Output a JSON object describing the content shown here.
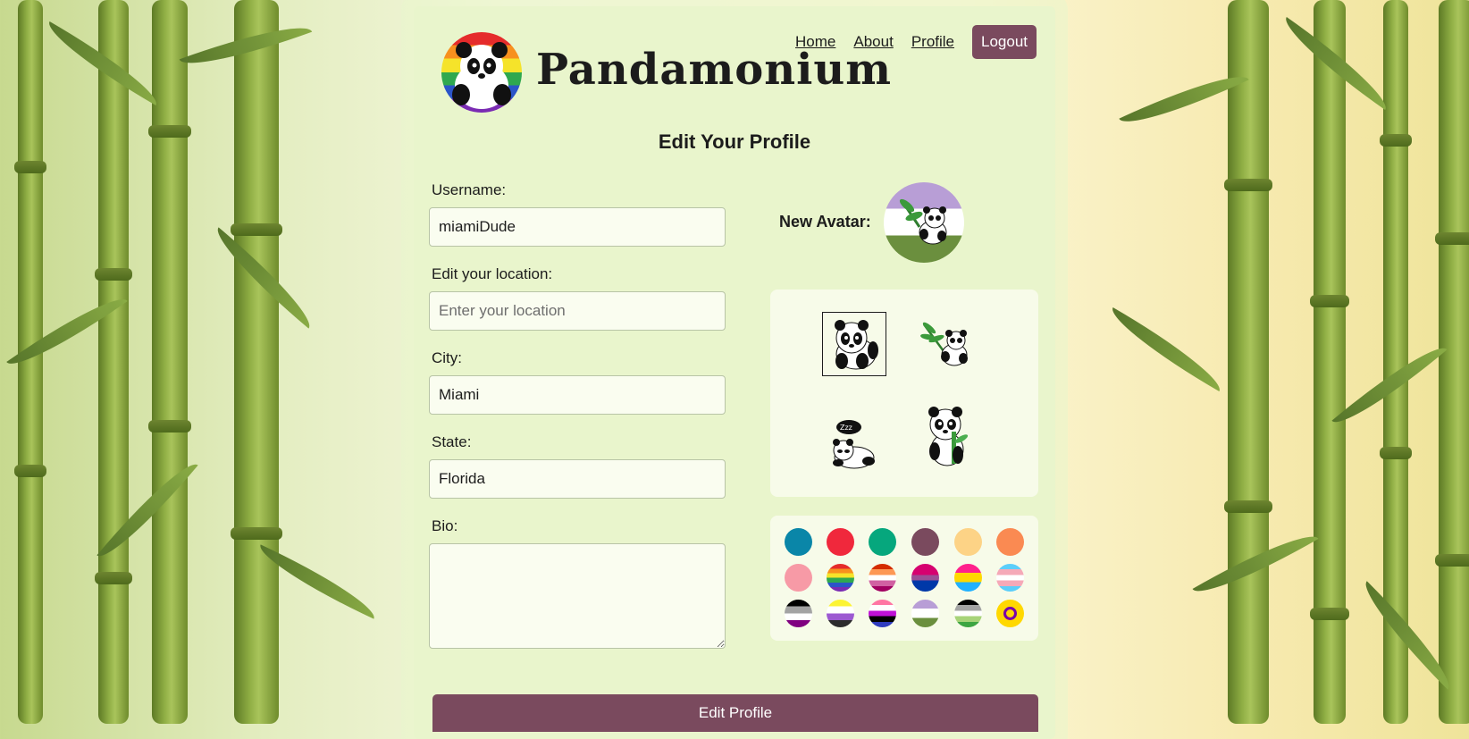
{
  "app": {
    "brand": "Pandamonium"
  },
  "nav": {
    "home": "Home",
    "about": "About",
    "profile": "Profile",
    "logout": "Logout"
  },
  "page": {
    "title": "Edit Your Profile"
  },
  "form": {
    "username_label": "Username:",
    "username_value": "miamiDude",
    "location_label": "Edit your location:",
    "location_placeholder": "Enter your location",
    "city_label": "City:",
    "city_value": "Miami",
    "state_label": "State:",
    "state_value": "Florida",
    "bio_label": "Bio:",
    "bio_value": "",
    "submit_label": "Edit Profile"
  },
  "avatar": {
    "new_avatar_label": "New Avatar:",
    "options": [
      "panda-sitting-icon",
      "panda-bamboo-icon",
      "panda-sleeping-icon",
      "panda-eating-icon"
    ],
    "selected_index": 0
  },
  "colors": {
    "solid": [
      "#0a86a8",
      "#f0283c",
      "#06a77d",
      "#7a4a5e",
      "#fdd386",
      "#fa8a52",
      "#f79aa6"
    ],
    "flags": [
      "rainbow-flag",
      "lesbian-flag",
      "bisexual-flag",
      "pansexual-flag",
      "transgender-flag",
      "asexual-flag",
      "nonbinary-flag",
      "genderfluid-flag",
      "agender-flag",
      "aromantic-flag",
      "intersex-flag"
    ]
  }
}
